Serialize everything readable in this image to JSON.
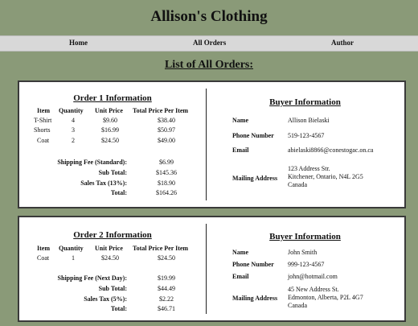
{
  "site": {
    "title": "Allison's Clothing"
  },
  "nav": {
    "items": [
      {
        "label": "Home"
      },
      {
        "label": "All Orders"
      },
      {
        "label": "Author"
      }
    ]
  },
  "page": {
    "heading": "List of All Orders:"
  },
  "table_headers": {
    "item": "Item",
    "quantity": "Quantity",
    "unit_price": "Unit Price",
    "total_price": "Total Price Per Item"
  },
  "orders": [
    {
      "title": "Order 1 Information",
      "items": [
        {
          "item": "T-Shirt",
          "quantity": "4",
          "unit_price": "$9.60",
          "total": "$38.40"
        },
        {
          "item": "Shorts",
          "quantity": "3",
          "unit_price": "$16.99",
          "total": "$50.97"
        },
        {
          "item": "Coat",
          "quantity": "2",
          "unit_price": "$24.50",
          "total": "$49.00"
        }
      ],
      "summary": [
        {
          "label": "Shipping Fee (Standard):",
          "value": "$6.99"
        },
        {
          "label": "Sub Total:",
          "value": "$145.36"
        },
        {
          "label": "Sales Tax (13%):",
          "value": "$18.90"
        },
        {
          "label": "Total:",
          "value": "$164.26"
        }
      ],
      "buyer": {
        "title": "Buyer Information",
        "name_label": "Name",
        "name": "Allison Bielaski",
        "phone_label": "Phone Number",
        "phone": "519-123-4567",
        "email_label": "Email",
        "email": "abielaski8866@conestogac.on.ca",
        "address_label": "Mailing Address",
        "address": [
          "123 Address Str.",
          "Kitchener, Ontario, N4L 2G5",
          "Canada"
        ]
      }
    },
    {
      "title": "Order 2 Information",
      "items": [
        {
          "item": "Coat",
          "quantity": "1",
          "unit_price": "$24.50",
          "total": "$24.50"
        }
      ],
      "summary": [
        {
          "label": "Shipping Fee (Next Day):",
          "value": "$19.99"
        },
        {
          "label": "Sub Total:",
          "value": "$44.49"
        },
        {
          "label": "Sales Tax (5%):",
          "value": "$2.22"
        },
        {
          "label": "Total:",
          "value": "$46.71"
        }
      ],
      "buyer": {
        "title": "Buyer Information",
        "name_label": "Name",
        "name": "John Smith",
        "phone_label": "Phone Number",
        "phone": "999-123-4567",
        "email_label": "Email",
        "email": "john@hotmail.com",
        "address_label": "Mailing Address",
        "address": [
          "45 New Address St.",
          "Edmonton, Alberta, P2L 4G7",
          "Canada"
        ]
      }
    }
  ]
}
